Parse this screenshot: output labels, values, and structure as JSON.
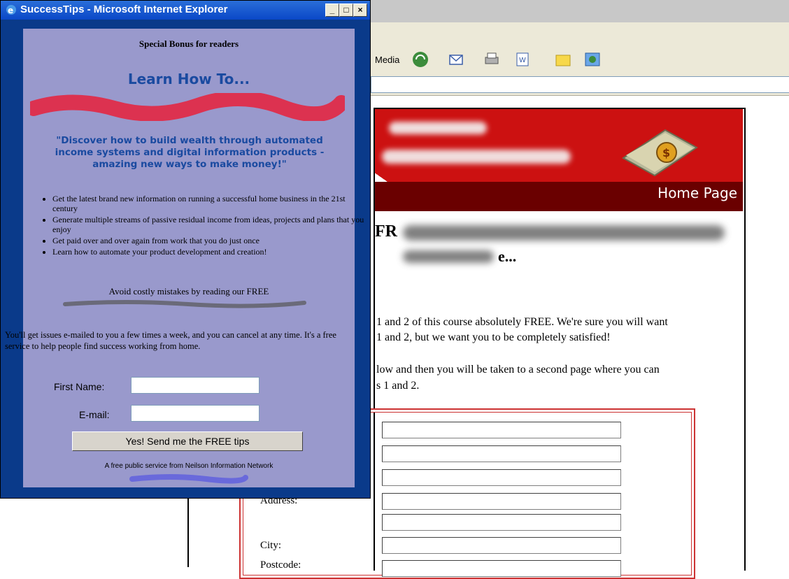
{
  "background_browser": {
    "toolbar": {
      "media_label": "Media"
    },
    "site": {
      "banner_label": "Home Page",
      "heading_fragment_1": "FR",
      "heading_fragment_2": "e...",
      "paragraph1_line1": "1 and 2 of this course absolutely FREE. We're sure you will want",
      "paragraph1_line2": "1 and 2, but we want you to be completely satisfied!",
      "paragraph2_line1": "low and then you will be taken to a second page where you can",
      "paragraph2_line2": "s 1 and 2.",
      "form_labels": {
        "address": "Address:",
        "city": "City:",
        "postcode": "Postcode:"
      }
    }
  },
  "popup": {
    "title": "SuccessTips - Microsoft Internet Explorer",
    "window_buttons": {
      "minimize": "_",
      "maximize": "□",
      "close": "×"
    },
    "bonus_title": "Special Bonus for readers",
    "learn_heading": "Learn How To...",
    "quote": "\"Discover how to build wealth through automated income systems and digital information products - amazing new ways to make money!\"",
    "bullets": [
      "Get the latest brand new information on running a successful home business in the 21st century",
      "Generate multiple streams of passive residual income from ideas, projects and plans that you enjoy",
      "Get paid over and over again from work that you do just once",
      "Learn how to automate your product development and creation!"
    ],
    "avoid_text": "Avoid costly mistakes by reading our FREE",
    "email_info": "You'll get  issues e-mailed to you a few times a week, and you can cancel at any time. It's a free service to help people find success working from home.",
    "form": {
      "first_name_label": "First Name:",
      "email_label": "E-mail:",
      "first_name_value": "",
      "email_value": "",
      "submit_label": "Yes! Send me the FREE tips"
    },
    "footer": "A free public service from Neilson Information Network"
  },
  "colors": {
    "popup_background": "#9999cc",
    "popup_frame": "#0a3a8a",
    "heading_blue": "#1a4aa0",
    "banner_red": "#cc1111"
  }
}
